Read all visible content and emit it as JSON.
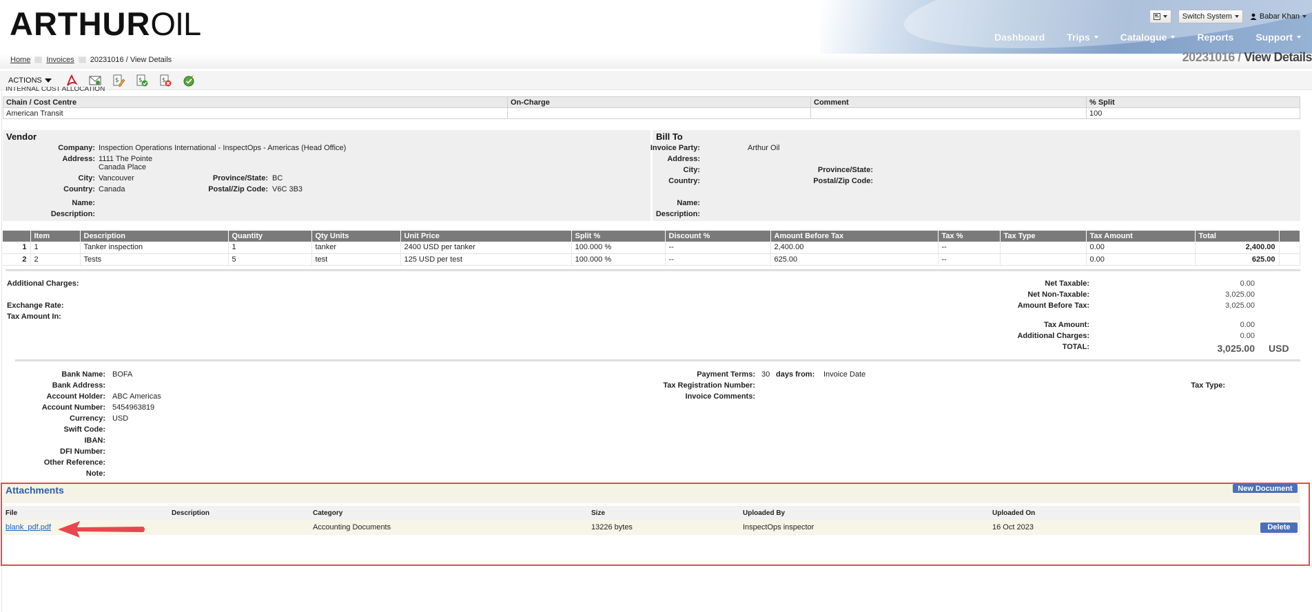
{
  "brand": {
    "name_bold": "ARTHUR",
    "name_light": "OIL"
  },
  "top": {
    "switch_system": "Switch System",
    "user": "Babar Khan"
  },
  "nav": [
    {
      "label": "Dashboard",
      "dropdown": false
    },
    {
      "label": "Trips",
      "dropdown": true
    },
    {
      "label": "Catalogue",
      "dropdown": true
    },
    {
      "label": "Reports",
      "dropdown": false
    },
    {
      "label": "Support",
      "dropdown": true
    }
  ],
  "breadcrumb": {
    "home": "Home",
    "invoices": "Invoices",
    "current": "20231016 / View Details"
  },
  "page_title": {
    "number": "20231016 /",
    "label": " View Details"
  },
  "actions": {
    "label": "ACTIONS"
  },
  "cost_allocation": {
    "section_label": "INTERNAL COST ALLOCATION",
    "headers": [
      "Chain / Cost Centre",
      "On-Charge",
      "Comment",
      "% Split"
    ],
    "rows": [
      [
        "American Transit",
        "",
        "",
        "100"
      ]
    ]
  },
  "vendor": {
    "title": "Vendor",
    "company_label": "Company:",
    "company": "Inspection Operations International - InspectOps - Americas (Head Office)",
    "address_label": "Address:",
    "address1": "1111 The Pointe",
    "address2": "Canada Place",
    "city_label": "City:",
    "city": "Vancouver",
    "province_label": "Province/State:",
    "province": "BC",
    "country_label": "Country:",
    "country": "Canada",
    "postal_label": "Postal/Zip Code:",
    "postal": "V6C 3B3",
    "name_label": "Name:",
    "description_label": "Description:"
  },
  "bill_to": {
    "title": "Bill To",
    "party_label": "Invoice Party:",
    "party": "Arthur Oil",
    "address_label": "Address:",
    "city_label": "City:",
    "province_label": "Province/State:",
    "country_label": "Country:",
    "postal_label": "Postal/Zip Code:",
    "name_label": "Name:",
    "description_label": "Description:"
  },
  "items": {
    "headers": [
      "",
      "Item",
      "Description",
      "Quantity",
      "Qty Units",
      "Unit Price",
      "Split %",
      "Discount %",
      "Amount Before Tax",
      "Tax %",
      "Tax Type",
      "Tax Amount",
      "Total"
    ],
    "rows": [
      [
        "1",
        "1",
        "Tanker inspection",
        "1",
        "tanker",
        "2400 USD per tanker",
        "100.000 %",
        "--",
        "2,400.00",
        "--",
        "",
        "0.00",
        "2,400.00"
      ],
      [
        "2",
        "2",
        "Tests",
        "5",
        "test",
        "125 USD per test",
        "100.000 %",
        "--",
        "625.00",
        "--",
        "",
        "0.00",
        "625.00"
      ]
    ]
  },
  "summary": {
    "additional_charges_label": "Additional Charges:",
    "exchange_rate_label": "Exchange Rate:",
    "tax_amount_in_label": "Tax Amount In:",
    "net_taxable_label": "Net Taxable:",
    "net_taxable": "0.00",
    "net_non_taxable_label": "Net Non-Taxable:",
    "net_non_taxable": "3,025.00",
    "amount_before_tax_label": "Amount Before Tax:",
    "amount_before_tax": "3,025.00",
    "tax_amount_label": "Tax Amount:",
    "tax_amount": "0.00",
    "add_charges_label": "Additional Charges:",
    "add_charges": "0.00",
    "total_label": "TOTAL:",
    "total": "3,025.00",
    "currency": "USD"
  },
  "bank": {
    "bank_name_label": "Bank Name:",
    "bank_name": "BOFA",
    "bank_address_label": "Bank Address:",
    "account_holder_label": "Account Holder:",
    "account_holder": "ABC Americas",
    "account_number_label": "Account Number:",
    "account_number": "5454963819",
    "currency_label": "Currency:",
    "currency": "USD",
    "swift_label": "Swift Code:",
    "iban_label": "IBAN:",
    "dfi_label": "DFI Number:",
    "other_ref_label": "Other Reference:",
    "note_label": "Note:",
    "payment_terms_label": "Payment Terms:",
    "payment_terms": "30",
    "days_from_label": "days from:",
    "days_from": "Invoice Date",
    "tax_reg_label": "Tax Registration Number:",
    "invoice_comments_label": "Invoice Comments:",
    "tax_type_label": "Tax Type:"
  },
  "attachments": {
    "title": "Attachments",
    "new_document": "New Document",
    "headers": [
      "File",
      "Description",
      "Category",
      "Size",
      "Uploaded By",
      "Uploaded On",
      ""
    ],
    "rows": [
      [
        "blank_pdf.pdf",
        "",
        "Accounting Documents",
        "13226 bytes",
        "InspectOps inspector",
        "16 Oct 2023"
      ]
    ],
    "delete": "Delete"
  },
  "colors": {
    "highlight": "#e8474f",
    "accent_blue": "#4a70b8",
    "table_header": "#7a7a7a"
  }
}
